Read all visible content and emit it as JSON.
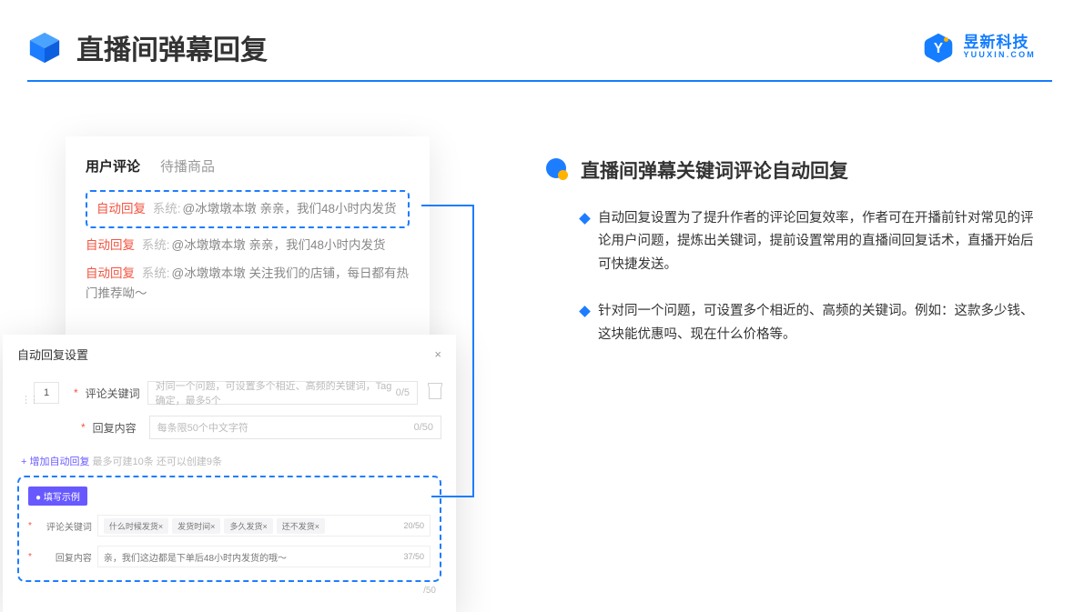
{
  "header": {
    "title": "直播间弹幕回复"
  },
  "brand": {
    "cn": "昱新科技",
    "en": "YUUXIN.COM"
  },
  "comments": {
    "tabs": {
      "active": "用户评论",
      "inactive": "待播商品"
    },
    "rows": {
      "r1_tag": "自动回复",
      "r1_mid": "系统:",
      "r1_txt": "@冰墩墩本墩 亲亲，我们48小时内发货",
      "r2_tag": "自动回复",
      "r2_mid": "系统:",
      "r2_txt": "@冰墩墩本墩 亲亲，我们48小时内发货",
      "r3_tag": "自动回复",
      "r3_mid": "系统:",
      "r3_txt": "@冰墩墩本墩 关注我们的店铺，每日都有热门推荐呦～"
    }
  },
  "modal": {
    "title": "自动回复设置",
    "close": "×",
    "row1_num": "1",
    "row1_label": "评论关键词",
    "row1_placeholder": "对同一个问题，可设置多个相近、高频的关键词，Tag确定，最多5个",
    "row1_count": "0/5",
    "row2_label": "回复内容",
    "row2_placeholder": "每条限50个中文字符",
    "row2_count": "0/50",
    "addline_link": "+ 增加自动回复",
    "addline_grey": "最多可建10条 还可以创建9条",
    "example_badge": "● 填写示例",
    "ex1_label": "评论关键词",
    "ex1_chip1": "什么时候发货×",
    "ex1_chip2": "发货时间×",
    "ex1_chip3": "多久发货×",
    "ex1_chip4": "还不发货×",
    "ex1_count": "20/50",
    "ex2_label": "回复内容",
    "ex2_text": "亲，我们这边都是下单后48小时内发货的哦～",
    "ex2_count": "37/50",
    "outer_count": "/50"
  },
  "right": {
    "title": "直播间弹幕关键词评论自动回复",
    "b1": "自动回复设置为了提升作者的评论回复效率，作者可在开播前针对常见的评论用户问题，提炼出关键词，提前设置常用的直播间回复话术，直播开始后可快捷发送。",
    "b2": "针对同一个问题，可设置多个相近的、高频的关键词。例如：这款多少钱、这块能优惠吗、现在什么价格等。"
  }
}
